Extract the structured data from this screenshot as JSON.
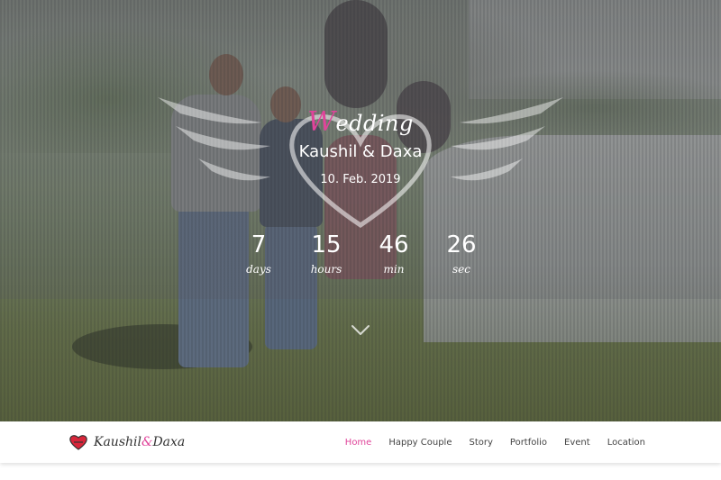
{
  "hero": {
    "title_first_letter": "W",
    "title_rest": "edding",
    "couple": "Kaushil & Daxa",
    "date": "10. Feb. 2019",
    "accent_color": "#e0449a",
    "countdown": [
      {
        "value": "7",
        "label": "days"
      },
      {
        "value": "15",
        "label": "hours"
      },
      {
        "value": "46",
        "label": "min"
      },
      {
        "value": "26",
        "label": "sec"
      }
    ],
    "scroll_icon": "chevron-down-icon"
  },
  "navbar": {
    "brand_first": "Kaushil",
    "brand_amp": "&",
    "brand_last": "Daxa",
    "brand_icon": "heart-icon",
    "links": [
      {
        "label": "Home",
        "active": true
      },
      {
        "label": "Happy Couple",
        "active": false
      },
      {
        "label": "Story",
        "active": false
      },
      {
        "label": "Portfolio",
        "active": false
      },
      {
        "label": "Event",
        "active": false
      },
      {
        "label": "Location",
        "active": false
      }
    ]
  }
}
